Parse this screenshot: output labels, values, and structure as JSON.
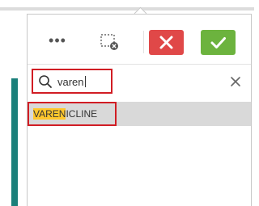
{
  "toolbar": {
    "more_label": "•••",
    "more_icon": "ellipsis-icon",
    "clear_selection_icon": "clear-selection-icon",
    "cancel_icon": "close-icon",
    "confirm_icon": "checkmark-icon",
    "cancel_color": "#e04848",
    "confirm_color": "#6cb33e"
  },
  "search": {
    "value": "varen",
    "search_icon": "search-icon",
    "clear_icon": "close-icon",
    "highlight_color": "#d11d24"
  },
  "results": [
    {
      "match": "VAREN",
      "rest": "ICLINE",
      "match_color": "#ffc72c"
    }
  ],
  "background": {
    "accent_strip_color": "#1a7f7a"
  }
}
